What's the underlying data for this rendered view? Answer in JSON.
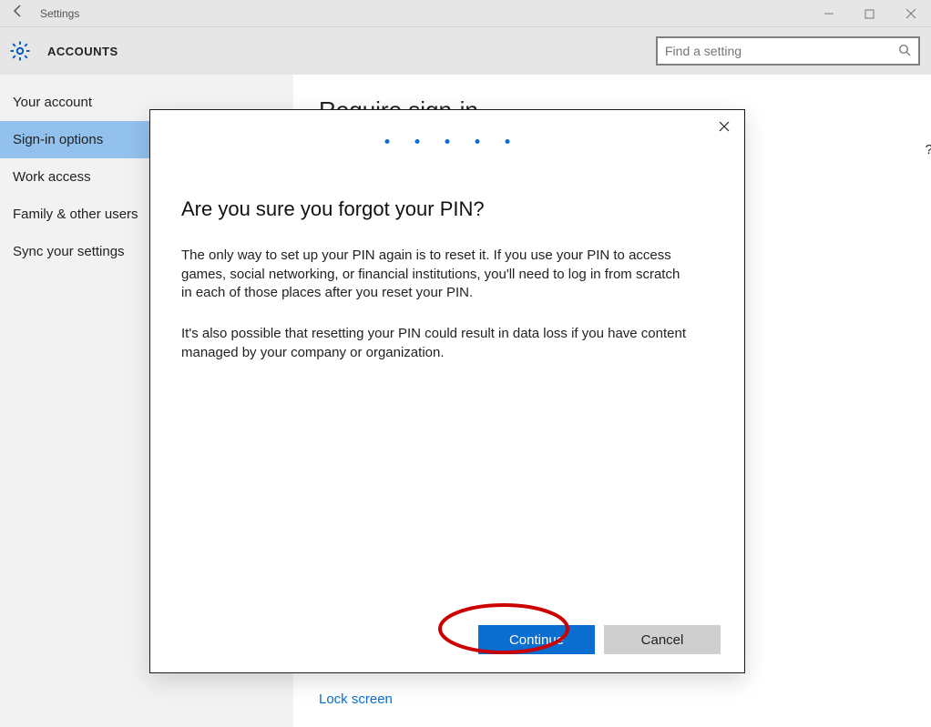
{
  "titlebar": {
    "title": "Settings"
  },
  "header": {
    "section_title": "ACCOUNTS",
    "search_placeholder": "Find a setting"
  },
  "sidebar": {
    "items": [
      {
        "label": "Your account",
        "selected": false
      },
      {
        "label": "Sign-in options",
        "selected": true
      },
      {
        "label": "Work access",
        "selected": false
      },
      {
        "label": "Family & other users",
        "selected": false
      },
      {
        "label": "Sync your settings",
        "selected": false
      }
    ]
  },
  "page": {
    "heading": "Require sign-in",
    "sub_question_fragment": "?",
    "lock_screen_link": "Lock screen"
  },
  "dialog": {
    "title": "Are you sure you forgot your PIN?",
    "para1": "The only way to set up your PIN again is to reset it. If you use your PIN to access games, social networking, or financial institutions, you'll need to log in from scratch in each of those places after you reset your PIN.",
    "para2": "It's also possible that resetting your PIN could result in data loss if you have content managed by your company or organization.",
    "continue_label": "Continue",
    "cancel_label": "Cancel"
  }
}
